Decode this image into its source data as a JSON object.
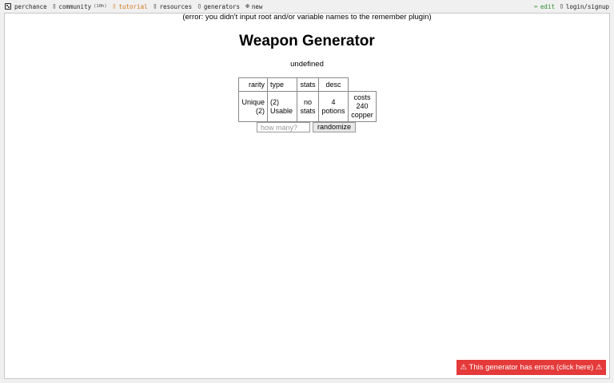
{
  "topbar": {
    "brand": "perchance",
    "community": "community",
    "community_count": "(10h)",
    "tutorial": "tutorial",
    "resources": "resources",
    "generators": "generators",
    "new": "new",
    "edit": "edit",
    "login": "login/signup",
    "icons": {
      "brand": "dice-icon",
      "community": "chat-icon",
      "tutorial": "book-icon",
      "resources": "book-icon",
      "generators": "list-icon",
      "new": "plus-circle-icon",
      "edit": "pencil-icon",
      "login": "user-icon"
    },
    "colors": {
      "tutorial": "#d4761a",
      "edit": "#2e8b2e"
    }
  },
  "page": {
    "error_line": "(error: you didn't input root and/or variable names to the remember plugin)",
    "title": "Weapon Generator",
    "output": "undefined"
  },
  "table": {
    "headers": [
      "rarity",
      "type",
      "stats",
      "desc",
      ""
    ],
    "row": [
      "Unique (2)",
      "(2) Usable",
      "no stats",
      "4 potions",
      "costs 240 copper"
    ]
  },
  "controls": {
    "count_placeholder": "how many?",
    "randomize_label": "randomize"
  },
  "error_banner": {
    "text": "⚠ This generator has errors (click here) ⚠",
    "color": "#e53a3a"
  }
}
